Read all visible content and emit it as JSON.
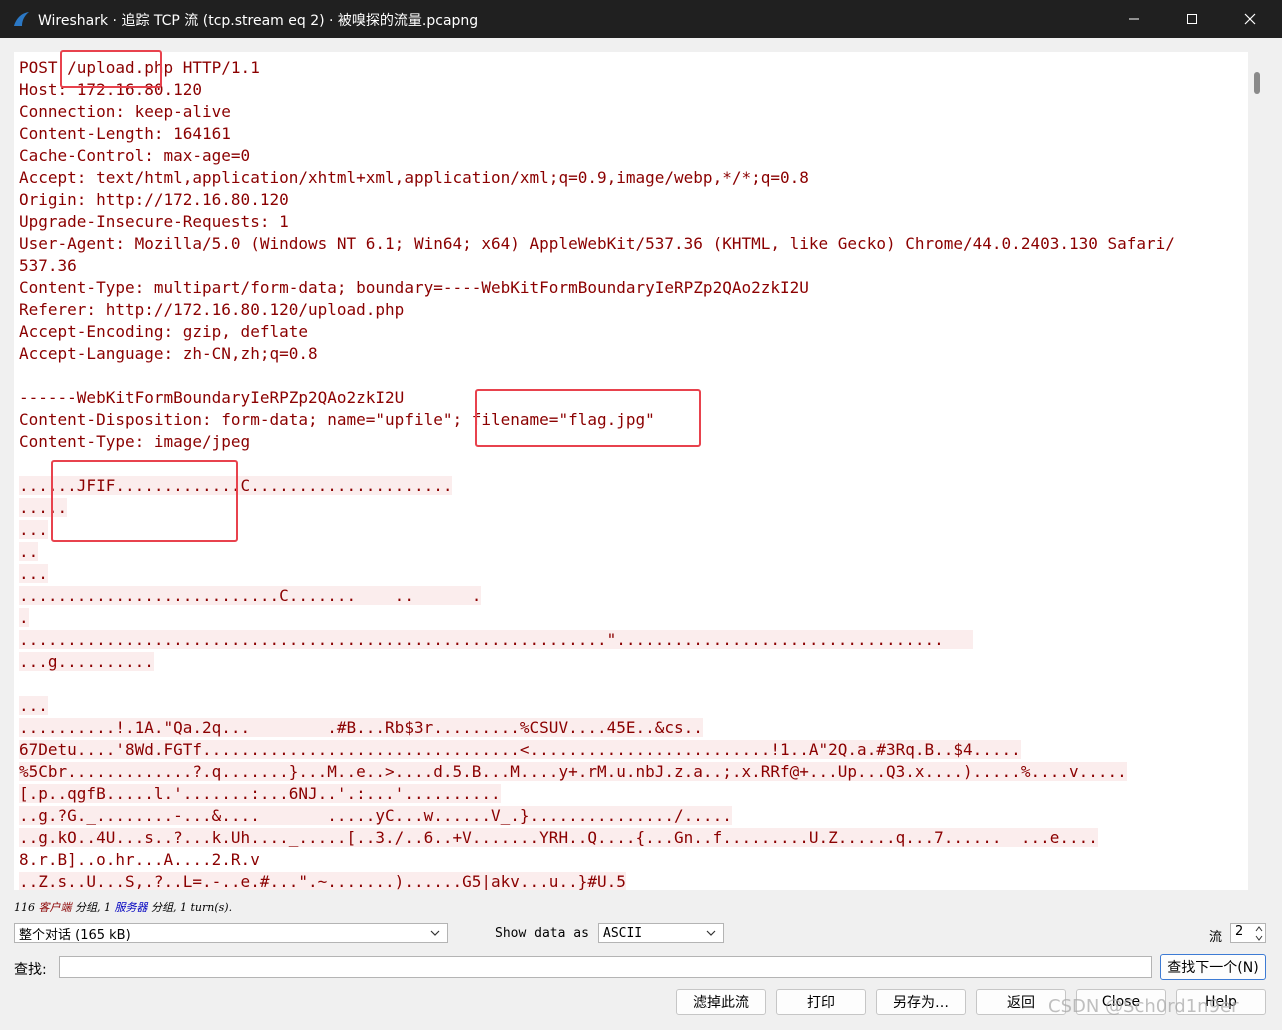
{
  "window": {
    "title": "Wireshark · 追踪 TCP 流 (tcp.stream eq 2) · 被嗅探的流量.pcapng"
  },
  "stream": {
    "lines": [
      {
        "text": "POST /upload.php HTTP/1.1",
        "highlight": false
      },
      {
        "text": "Host: 172.16.80.120",
        "highlight": false
      },
      {
        "text": "Connection: keep-alive",
        "highlight": false
      },
      {
        "text": "Content-Length: 164161",
        "highlight": false
      },
      {
        "text": "Cache-Control: max-age=0",
        "highlight": false
      },
      {
        "text": "Accept: text/html,application/xhtml+xml,application/xml;q=0.9,image/webp,*/*;q=0.8",
        "highlight": false
      },
      {
        "text": "Origin: http://172.16.80.120",
        "highlight": false
      },
      {
        "text": "Upgrade-Insecure-Requests: 1",
        "highlight": false
      },
      {
        "text": "User-Agent: Mozilla/5.0 (Windows NT 6.1; Win64; x64) AppleWebKit/537.36 (KHTML, like Gecko) Chrome/44.0.2403.130 Safari/",
        "highlight": false
      },
      {
        "text": "537.36",
        "highlight": false
      },
      {
        "text": "Content-Type: multipart/form-data; boundary=----WebKitFormBoundaryIeRPZp2QAo2zkI2U",
        "highlight": false
      },
      {
        "text": "Referer: http://172.16.80.120/upload.php",
        "highlight": false
      },
      {
        "text": "Accept-Encoding: gzip, deflate",
        "highlight": false
      },
      {
        "text": "Accept-Language: zh-CN,zh;q=0.8",
        "highlight": false
      },
      {
        "text": "",
        "highlight": false
      },
      {
        "text": "------WebKitFormBoundaryIeRPZp2QAo2zkI2U",
        "highlight": false
      },
      {
        "text": "Content-Disposition: form-data; name=\"upfile\"; filename=\"flag.jpg\"",
        "highlight": false
      },
      {
        "text": "Content-Type: image/jpeg",
        "highlight": false
      },
      {
        "text": "",
        "highlight": false
      },
      {
        "text": "......JFIF.............C.....................",
        "highlight": true
      },
      {
        "text": ".....",
        "highlight": true
      },
      {
        "text": "...",
        "highlight": true
      },
      {
        "text": "..",
        "highlight": true
      },
      {
        "text": "...",
        "highlight": true
      },
      {
        "text": "...........................C.......    ..      .",
        "highlight": true
      },
      {
        "text": ".",
        "highlight": true
      },
      {
        "text": ".............................................................\"..................................   ",
        "highlight": true
      },
      {
        "text": "...g..........",
        "highlight": true
      },
      {
        "text": "",
        "highlight": false
      },
      {
        "text": "...",
        "highlight": true
      },
      {
        "text": "..........!.1A.\"Qa.2q...        .#B...Rb$3r.........%CSUV....45E..&cs..",
        "highlight": true
      },
      {
        "text": "67Detu....'8Wd.FGTf.................................<.........................!1..A\"2Q.a.#3Rq.B..$4.....",
        "highlight": true
      },
      {
        "text": "%5Cbr.............?.q.......}...M..e..>....d.5.B...M....y+.rM.u.nbJ.z.a..;.x.RRf@+...Up...Q3.x....).....%....v.....",
        "highlight": true
      },
      {
        "text": "[.p..qgfB.....l.'.......:...6NJ..'.:...'..........",
        "highlight": true
      },
      {
        "text": "..g.?G._........-...&....       .....yC...w......V_.}.............../.....",
        "highlight": true
      },
      {
        "text": "..g.kO..4U...s..?...k.Uh...._.....[..3./..6..+V.......YRH..Q....{...Gn..f.........U.Z......q...7......  ...e....",
        "highlight": true
      },
      {
        "text": "8.r.B]..o.hr...A....2.R.v",
        "highlight": false
      },
      {
        "text": "..Z.s..U...S,.?..L=.-..e.#...\".~.......)......G5|akv...u..}#U.5",
        "highlight": true
      }
    ]
  },
  "status": {
    "count_client": "116",
    "client_label": "客户端",
    "text1": " 分组,",
    "count_server": "1",
    "server_label": "服务器",
    "text2": " 分组,",
    "turns": "1 turn(s)."
  },
  "controls": {
    "conversation_select": "整个对话 (165 kB)",
    "show_data_as_label": "Show data as",
    "show_data_as_value": "ASCII",
    "stream_label": "流",
    "stream_value": "2",
    "find_label": "查找:",
    "find_value": "",
    "find_next_button": "查找下一个(N)"
  },
  "buttons": {
    "filter_out": "滤掉此流",
    "print": "打印",
    "save_as": "另存为…",
    "back": "返回",
    "close": "Close",
    "help": "Help"
  },
  "watermark": "CSDN @Sch0rd1n9er",
  "colors": {
    "client_text": "#8b0000",
    "client_bg": "#fbeded",
    "server_text": "#0000c0",
    "annotation": "#e8424d"
  }
}
